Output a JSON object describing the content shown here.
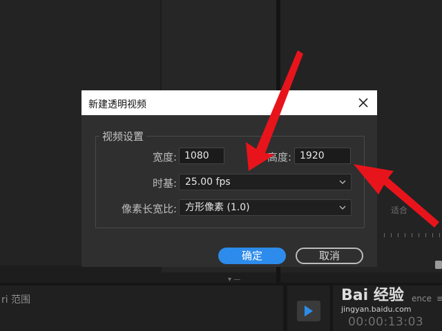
{
  "dialog": {
    "title": "新建透明视频",
    "group_label": "视频设置",
    "width_label": "宽度:",
    "width_value": "1080",
    "height_label": "高度:",
    "height_value": "1920",
    "timebase_label": "时基:",
    "timebase_value": "25.00 fps",
    "pixel_aspect_label": "像素长宽比:",
    "pixel_aspect_value": "方形像素 (1.0)",
    "ok_label": "确定",
    "cancel_label": "取消"
  },
  "background": {
    "project_panel_text": "ri 范围",
    "timeline_label": "ence",
    "menu_icon": "≡",
    "timecode": "00:00:13:03",
    "volume_label": "适合"
  },
  "watermark": {
    "logo": "Bai 经验",
    "url": "jingyan.baidu.com"
  },
  "colors": {
    "accent": "#2d8ceb",
    "arrow": "#e8141c",
    "dialog_bg": "#2f2f2f"
  }
}
